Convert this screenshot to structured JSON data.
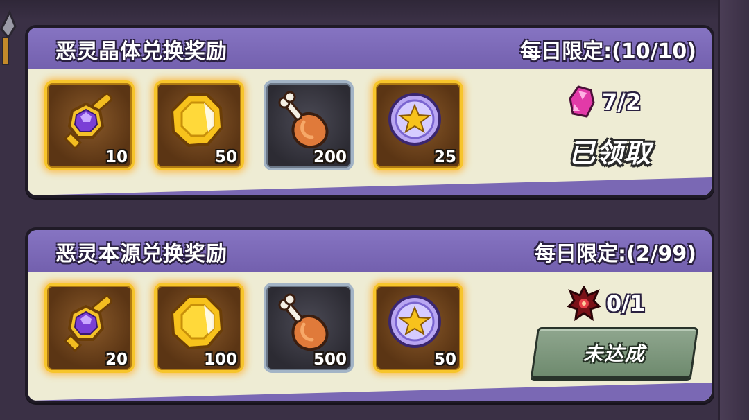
{
  "cards": [
    {
      "title": "恶灵晶体兑换奖励",
      "limit": "每日限定:(10/10)",
      "rewards": [
        {
          "icon": "amulet-icon",
          "qty": "10"
        },
        {
          "icon": "gold-coin-icon",
          "qty": "50"
        },
        {
          "icon": "meat-drumstick-icon",
          "qty": "200"
        },
        {
          "icon": "star-coin-icon",
          "qty": "25"
        }
      ],
      "cost": {
        "icon": "pink-crystal-icon",
        "text": "7/2"
      },
      "status": "已领取"
    },
    {
      "title": "恶灵本源兑换奖励",
      "limit": "每日限定:(2/99)",
      "rewards": [
        {
          "icon": "amulet-icon",
          "qty": "20"
        },
        {
          "icon": "gold-coin-icon",
          "qty": "100"
        },
        {
          "icon": "meat-drumstick-icon",
          "qty": "500"
        },
        {
          "icon": "star-coin-icon",
          "qty": "50"
        }
      ],
      "cost": {
        "icon": "dark-origin-icon",
        "text": "0/1"
      },
      "button": "未达成"
    }
  ],
  "colors": {
    "header": "#7a68b4",
    "body": "#eeecd4",
    "gold_frame": "#f7c52b",
    "gray_frame": "#a3b4c6",
    "button": "#7e987e"
  }
}
